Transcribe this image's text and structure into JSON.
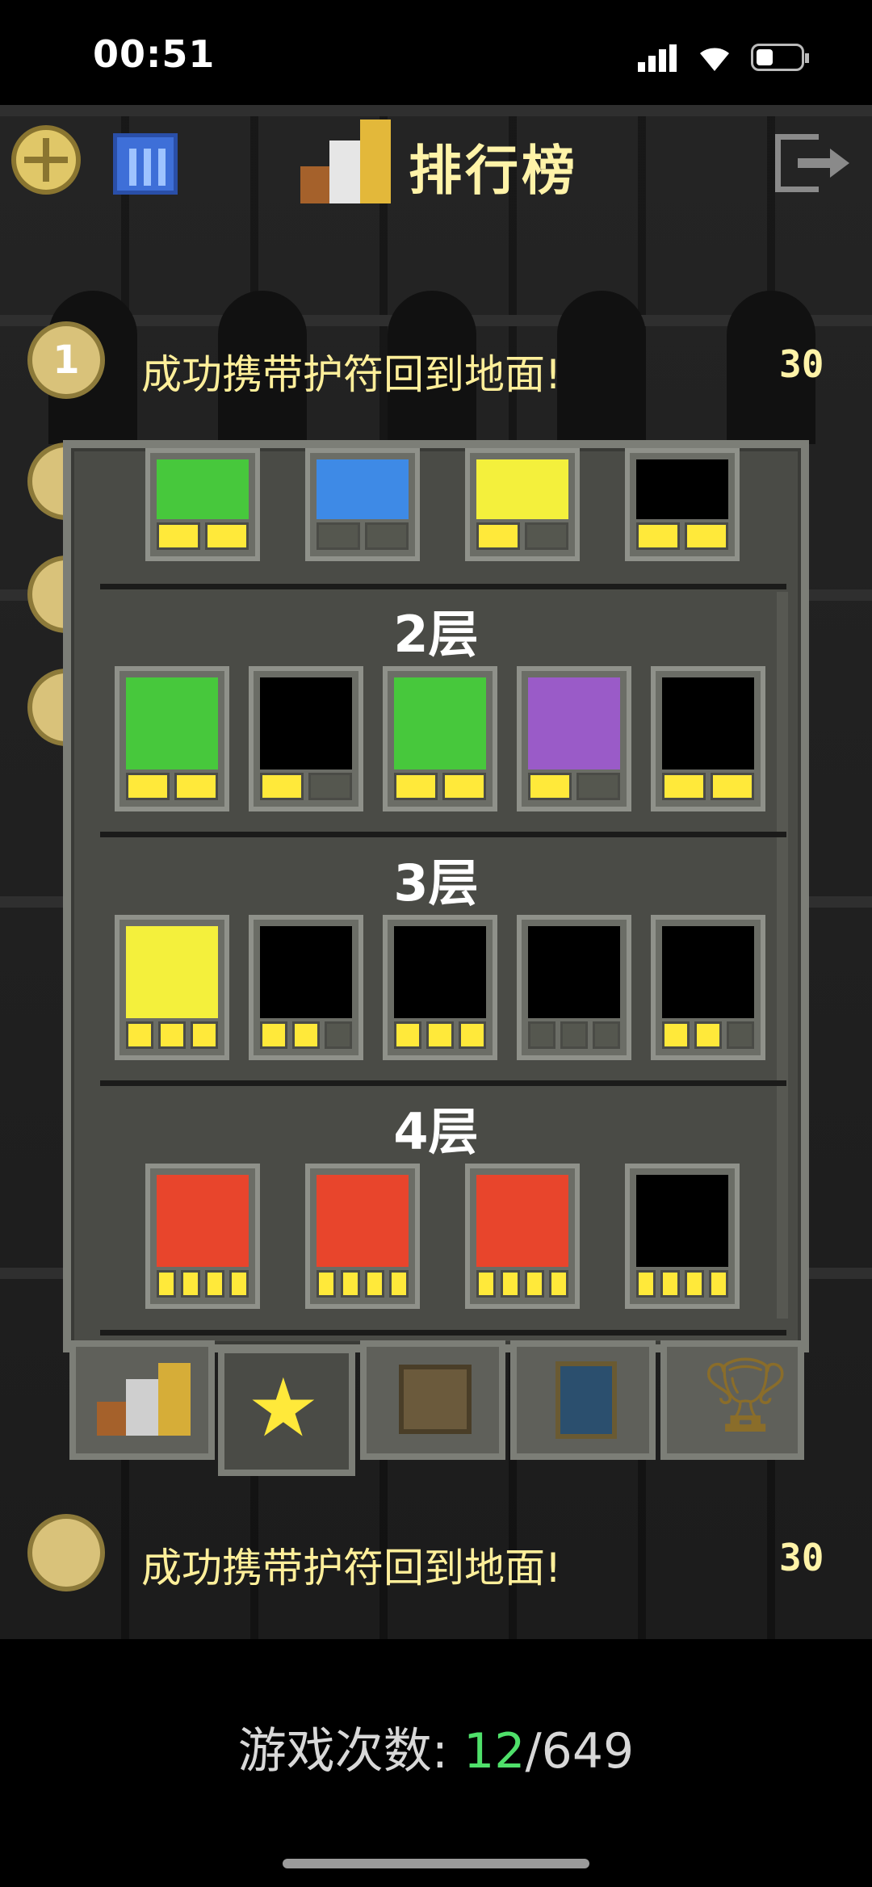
{
  "status_bar": {
    "time": "00:51"
  },
  "header": {
    "title": "排行榜",
    "icons": [
      "challenge-badge-icon",
      "calendar-icon",
      "podium-icon",
      "exit-icon"
    ]
  },
  "rows": [
    {
      "rank": "1",
      "text": "成功携带护符回到地面!",
      "score": "30"
    },
    {
      "rank": "",
      "text": "成功携带护符回到地面!",
      "score": "30"
    }
  ],
  "modal": {
    "tiers": [
      {
        "label": "2层"
      },
      {
        "label": "3层"
      },
      {
        "label": "4层"
      }
    ]
  },
  "tabs": [
    "rankings-tab",
    "badges-tab",
    "journal-tab",
    "catalog-tab",
    "trophy-tab"
  ],
  "footer": {
    "label": "游戏次数:",
    "current": "12",
    "separator": "/",
    "total": "649"
  },
  "colors": {
    "accent": "#ffef9a",
    "green": "#4fe06a",
    "panel": "#4a4b46"
  }
}
